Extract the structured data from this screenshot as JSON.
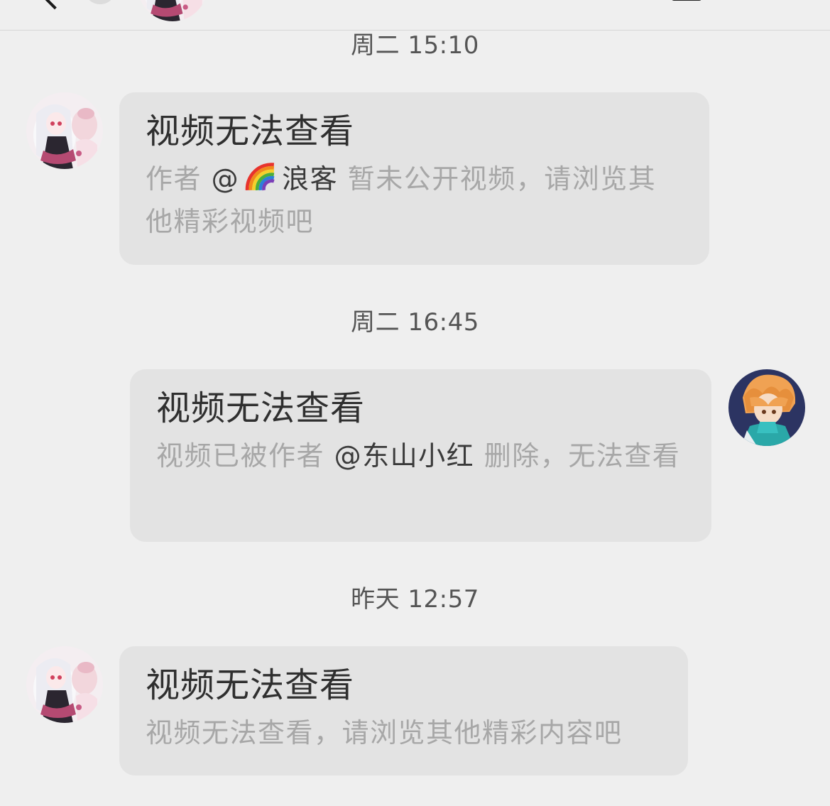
{
  "messages": [
    {
      "time": "周二 15:10",
      "side": "left",
      "title": "视频无法查看",
      "body_pre": "作者 ",
      "mention_at": "@",
      "mention_icon": "rainbow-emoji",
      "mention_name": "浪客",
      "body_post": " 暂未公开视频，请浏览其他精彩视频吧"
    },
    {
      "time": "周二 16:45",
      "side": "right",
      "title": "视频无法查看",
      "body_pre": "视频已被作者 ",
      "mention_at": "@",
      "mention_name": "东山小红",
      "body_post": " 删除，无法查看"
    },
    {
      "time": "昨天 12:57",
      "side": "left",
      "title": "视频无法查看",
      "body_pre": "视频无法查看，请浏览其他精彩内容吧"
    }
  ],
  "colors": {
    "background": "#efefef",
    "bubble": "#e3e3e3",
    "title_text": "#2f2f2f",
    "body_text": "#a7a7a7",
    "mention_text": "#3a3a3a",
    "timestamp_text": "#555555"
  },
  "icons": {
    "back": "back-chevron-icon",
    "more": "more-menu-icon"
  }
}
